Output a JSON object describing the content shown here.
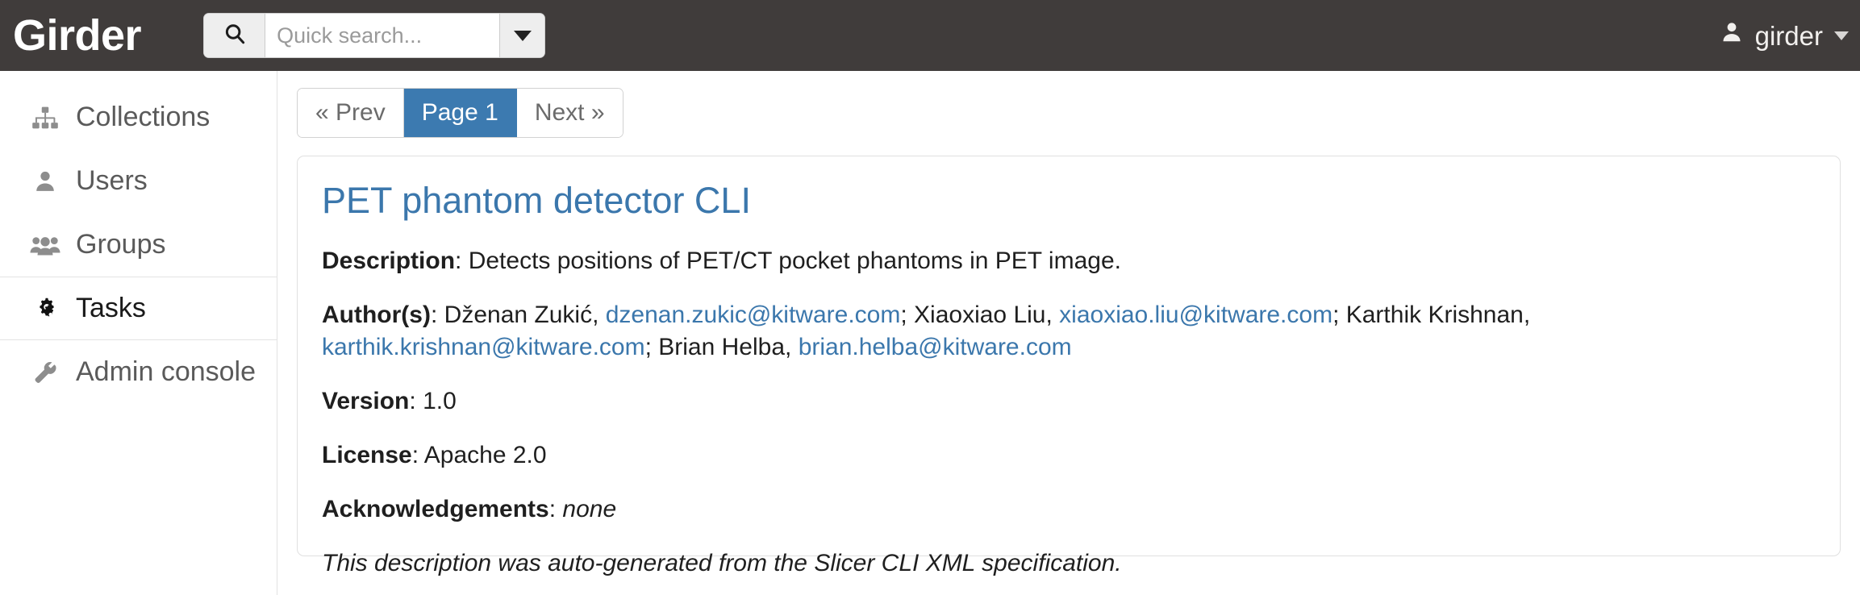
{
  "navbar": {
    "brand": "Girder",
    "search": {
      "placeholder": "Quick search...",
      "value": "",
      "icon": "search-icon",
      "caret_icon": "caret-down-icon"
    },
    "user": {
      "name": "girder",
      "icon": "user-icon",
      "caret_icon": "caret-down-icon"
    },
    "background_color": "#403c3b"
  },
  "sidebar": {
    "items": [
      {
        "label": "Collections",
        "icon": "sitemap-icon",
        "active": false
      },
      {
        "label": "Users",
        "icon": "user-icon",
        "active": false
      },
      {
        "label": "Groups",
        "icon": "users-icon",
        "active": false
      },
      {
        "label": "Tasks",
        "icon": "cogs-icon",
        "active": true
      },
      {
        "label": "Admin console",
        "icon": "wrench-icon",
        "active": false
      }
    ]
  },
  "main": {
    "pagination": {
      "prev_label": "« Prev",
      "page_label": "Page 1",
      "next_label": "Next »",
      "active_color": "#3c7ab0"
    },
    "task_card": {
      "title": "PET phantom detector CLI",
      "description_label": "Description",
      "description_value": "Detects positions of PET/CT pocket phantoms in PET image.",
      "authors_label": "Author(s)",
      "authors": [
        {
          "name": "Dženan Zukić",
          "email": "dzenan.zukic@kitware.com",
          "separator": "; "
        },
        {
          "name": "Xiaoxiao Liu",
          "email": "xiaoxiao.liu@kitware.com",
          "separator": "; "
        },
        {
          "name": "Karthik Krishnan",
          "email": "karthik.krishnan@kitware.com",
          "separator": "; "
        },
        {
          "name": "Brian Helba",
          "email": "brian.helba@kitware.com",
          "separator": ""
        }
      ],
      "version_label": "Version",
      "version_value": "1.0",
      "license_label": "License",
      "license_value": "Apache 2.0",
      "acknowledgements_label": "Acknowledgements",
      "acknowledgements_value": "none",
      "note": "This description was auto-generated from the Slicer CLI XML specification.",
      "link_color": "#3b77ac"
    }
  }
}
